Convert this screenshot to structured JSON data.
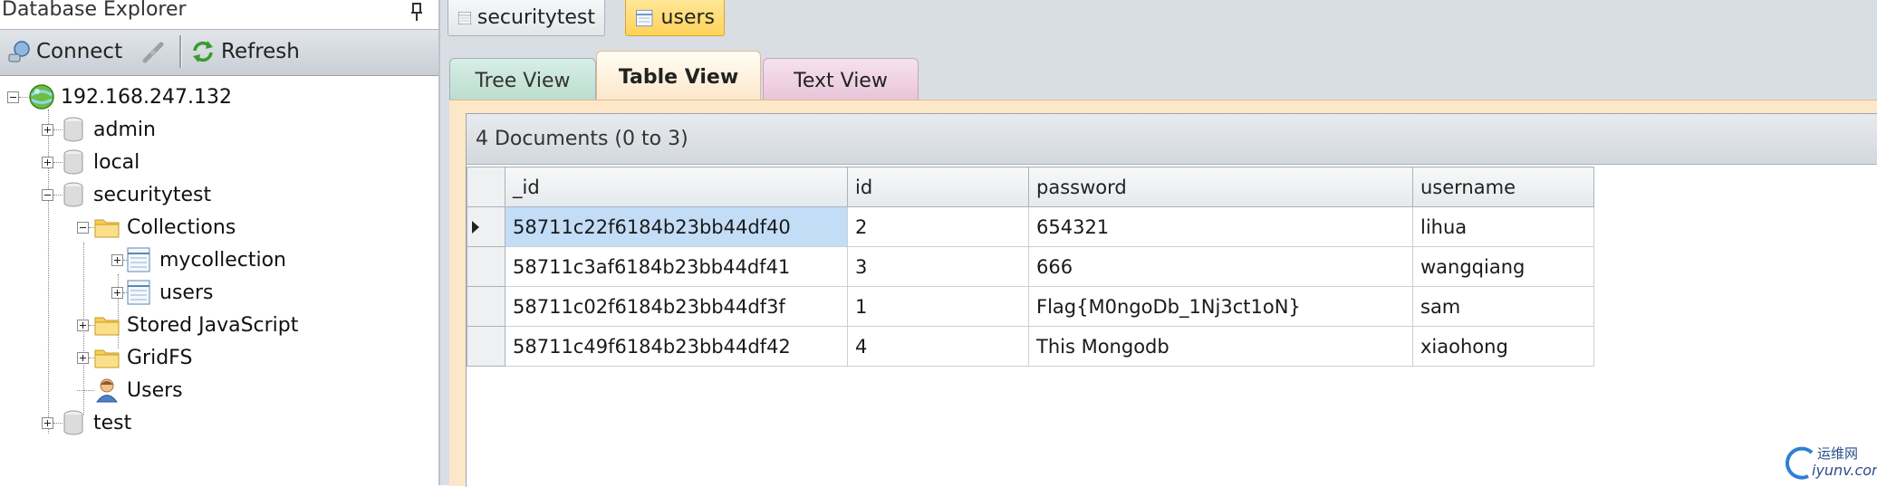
{
  "explorer": {
    "title": "Database Explorer",
    "toolbar": {
      "connect_label": "Connect",
      "refresh_label": "Refresh"
    },
    "tree": {
      "server": "192.168.247.132",
      "databases": [
        "admin",
        "local",
        "securitytest",
        "test"
      ],
      "securitytest_children": {
        "collections_label": "Collections",
        "collections": [
          "mycollection",
          "users"
        ],
        "stored_js_label": "Stored JavaScript",
        "gridfs_label": "GridFS",
        "users_label": "Users"
      }
    }
  },
  "doc_tabs": [
    {
      "label": "securitytest",
      "active": false
    },
    {
      "label": "users",
      "active": true
    }
  ],
  "view_tabs": [
    {
      "label": "Tree View",
      "active": false
    },
    {
      "label": "Table View",
      "active": true
    },
    {
      "label": "Text View",
      "active": false
    }
  ],
  "grid": {
    "caption": "4 Documents (0 to 3)",
    "columns": [
      "_id",
      "id",
      "password",
      "username"
    ],
    "rows": [
      [
        "58711c22f6184b23bb44df40",
        "2",
        "654321",
        "lihua"
      ],
      [
        "58711c3af6184b23bb44df41",
        "3",
        "666",
        "wangqiang"
      ],
      [
        "58711c02f6184b23bb44df3f",
        "1",
        "Flag{M0ngoDb_1Nj3ct1oN}",
        "sam"
      ],
      [
        "58711c49f6184b23bb44df42",
        "4",
        "This Mongodb",
        "xiaohong"
      ]
    ],
    "selected_row": 0
  },
  "watermark": {
    "cn": "运维网",
    "url": "iyunv.com"
  },
  "colors": {
    "active_doc_tab": "#ffd35a",
    "table_view_bg": "#fde7c9",
    "selection": "#c3ddf7"
  }
}
